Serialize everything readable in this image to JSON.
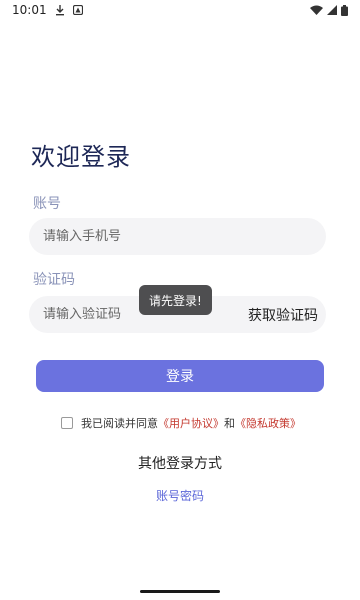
{
  "status_bar": {
    "time": "10:01"
  },
  "login": {
    "title": "欢迎登录",
    "account_label": "账号",
    "phone_placeholder": "请输入手机号",
    "code_label": "验证码",
    "code_placeholder": "请输入验证码",
    "get_code_label": "获取验证码",
    "toast_message": "请先登录!",
    "login_button": "登录",
    "agreement_prefix": "我已阅读并同意",
    "user_agreement_link": "《用户协议》",
    "agreement_and": "和",
    "privacy_policy_link": "《隐私政策》",
    "agreement_checked": false,
    "other_methods_label": "其他登录方式",
    "account_password_link": "账号密码"
  },
  "colors": {
    "primary": "#6b72df",
    "title": "#1d2756",
    "label": "#8a93b8",
    "input_bg": "#f4f4f6",
    "link_red": "#c4382e",
    "toast_bg": "#4e4e50"
  },
  "icons": {
    "status_left": [
      "download-icon",
      "notification-icon"
    ],
    "status_right": [
      "wifi-icon",
      "cellular-signal-icon",
      "battery-icon"
    ]
  }
}
